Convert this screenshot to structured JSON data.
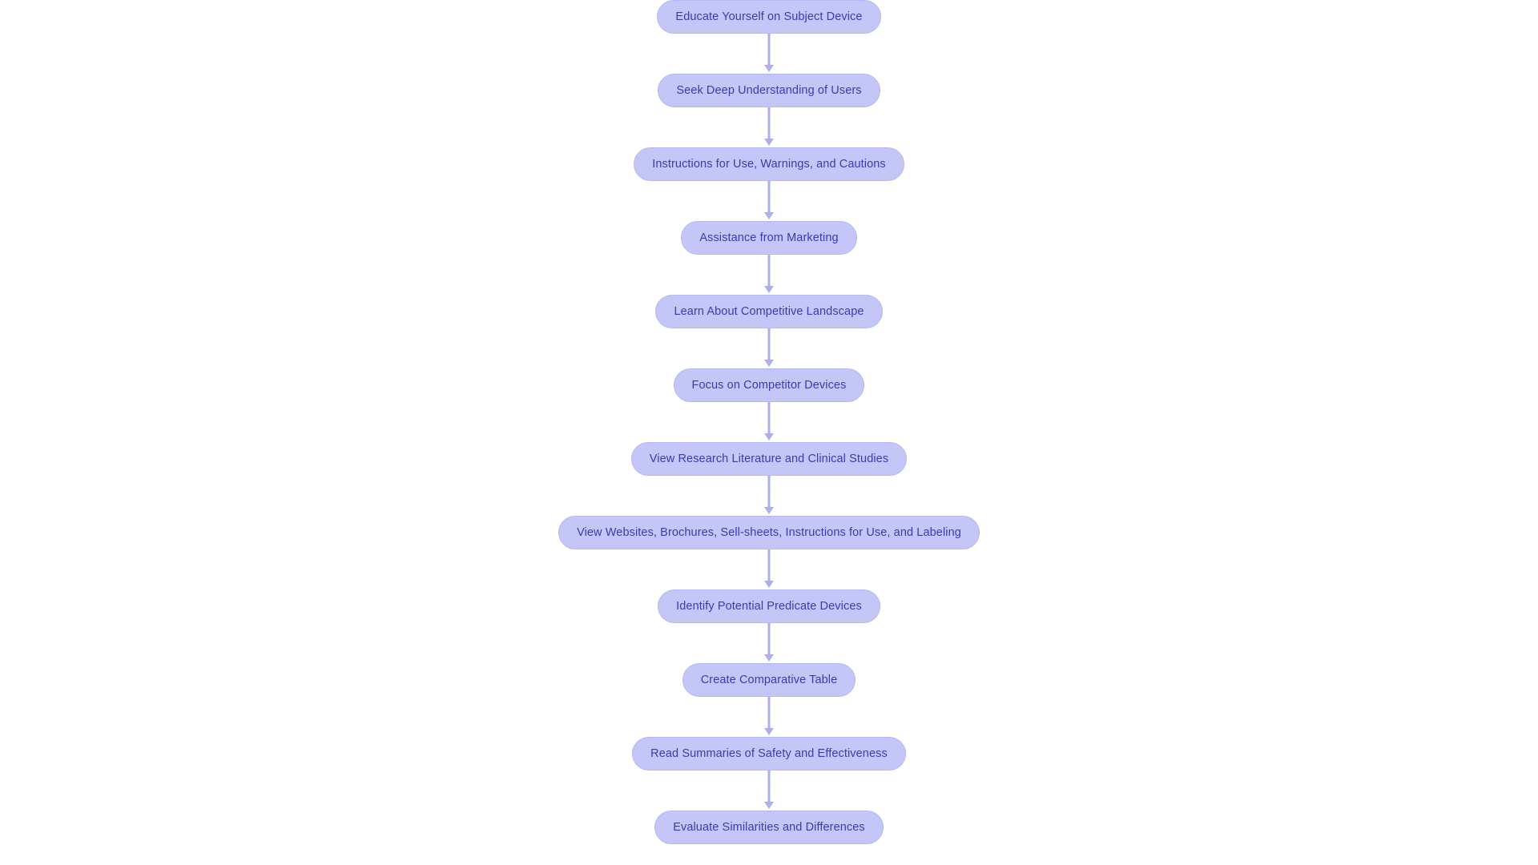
{
  "diagram": {
    "type": "flowchart",
    "orientation": "top-to-bottom",
    "background_color": "#ffffff",
    "node_fill_color": "#c3c6f7",
    "node_border_color": "#b4b8f2",
    "node_text_color": "#3b3bb0",
    "connector_color": "#aab0ec",
    "node_shape": "stadium",
    "nodes": [
      {
        "id": "n1",
        "label": "Educate Yourself on Subject Device"
      },
      {
        "id": "n2",
        "label": "Seek Deep Understanding of Users"
      },
      {
        "id": "n3",
        "label": "Instructions for Use, Warnings, and Cautions"
      },
      {
        "id": "n4",
        "label": "Assistance from Marketing"
      },
      {
        "id": "n5",
        "label": "Learn About Competitive Landscape"
      },
      {
        "id": "n6",
        "label": "Focus on Competitor Devices"
      },
      {
        "id": "n7",
        "label": "View Research Literature and Clinical Studies"
      },
      {
        "id": "n8",
        "label": "View Websites, Brochures, Sell-sheets, Instructions for Use, and Labeling"
      },
      {
        "id": "n9",
        "label": "Identify Potential Predicate Devices"
      },
      {
        "id": "n10",
        "label": "Create Comparative Table"
      },
      {
        "id": "n11",
        "label": "Read Summaries of Safety and Effectiveness"
      },
      {
        "id": "n12",
        "label": "Evaluate Similarities and Differences"
      }
    ],
    "edges": [
      {
        "from": "n1",
        "to": "n2",
        "arrow": "arrow-down-icon"
      },
      {
        "from": "n2",
        "to": "n3",
        "arrow": "arrow-down-icon"
      },
      {
        "from": "n3",
        "to": "n4",
        "arrow": "arrow-down-icon"
      },
      {
        "from": "n4",
        "to": "n5",
        "arrow": "arrow-down-icon"
      },
      {
        "from": "n5",
        "to": "n6",
        "arrow": "arrow-down-icon"
      },
      {
        "from": "n6",
        "to": "n7",
        "arrow": "arrow-down-icon"
      },
      {
        "from": "n7",
        "to": "n8",
        "arrow": "arrow-down-icon"
      },
      {
        "from": "n8",
        "to": "n9",
        "arrow": "arrow-down-icon"
      },
      {
        "from": "n9",
        "to": "n10",
        "arrow": "arrow-down-icon"
      },
      {
        "from": "n10",
        "to": "n11",
        "arrow": "arrow-down-icon"
      },
      {
        "from": "n11",
        "to": "n12",
        "arrow": "arrow-down-icon"
      }
    ]
  }
}
